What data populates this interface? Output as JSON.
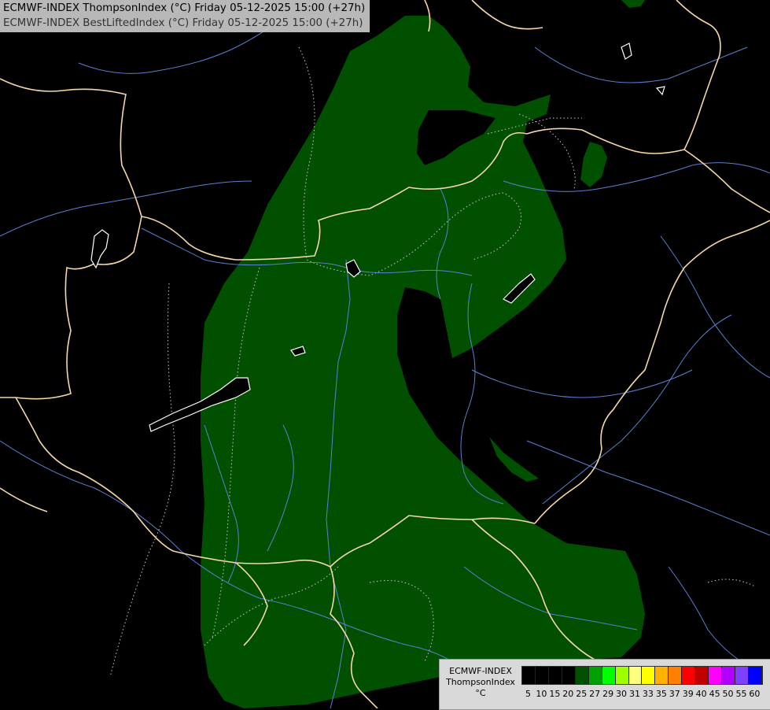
{
  "header": {
    "line1": "ECMWF-INDEX ThompsonIndex (°C) Friday 05-12-2025 15:00 (+27h)",
    "line2": "ECMWF-INDEX BestLiftedIndex (°C) Friday 05-12-2025 15:00 (+27h)"
  },
  "legend": {
    "model": "ECMWF-INDEX",
    "param": "ThompsonIndex",
    "unit": "°C",
    "ticks": [
      "5",
      "10",
      "15",
      "20",
      "25",
      "27",
      "29",
      "30",
      "31",
      "33",
      "35",
      "37",
      "39",
      "40",
      "45",
      "50",
      "55",
      "60"
    ],
    "colors": [
      "#000000",
      "#000000",
      "#000000",
      "#000000",
      "#005000",
      "#00a000",
      "#00ff00",
      "#9fff00",
      "#ffff7f",
      "#ffff00",
      "#ffb000",
      "#ff8000",
      "#ff0000",
      "#c00000",
      "#ff00ff",
      "#b000ff",
      "#7f3fff",
      "#0000ff"
    ]
  },
  "map": {
    "fill_color": "#005000",
    "border_color": "#f5d7a8",
    "river_color": "#5c7fd0",
    "lake_color": "#ffffff",
    "isoline_color": "#c8c8c8"
  }
}
